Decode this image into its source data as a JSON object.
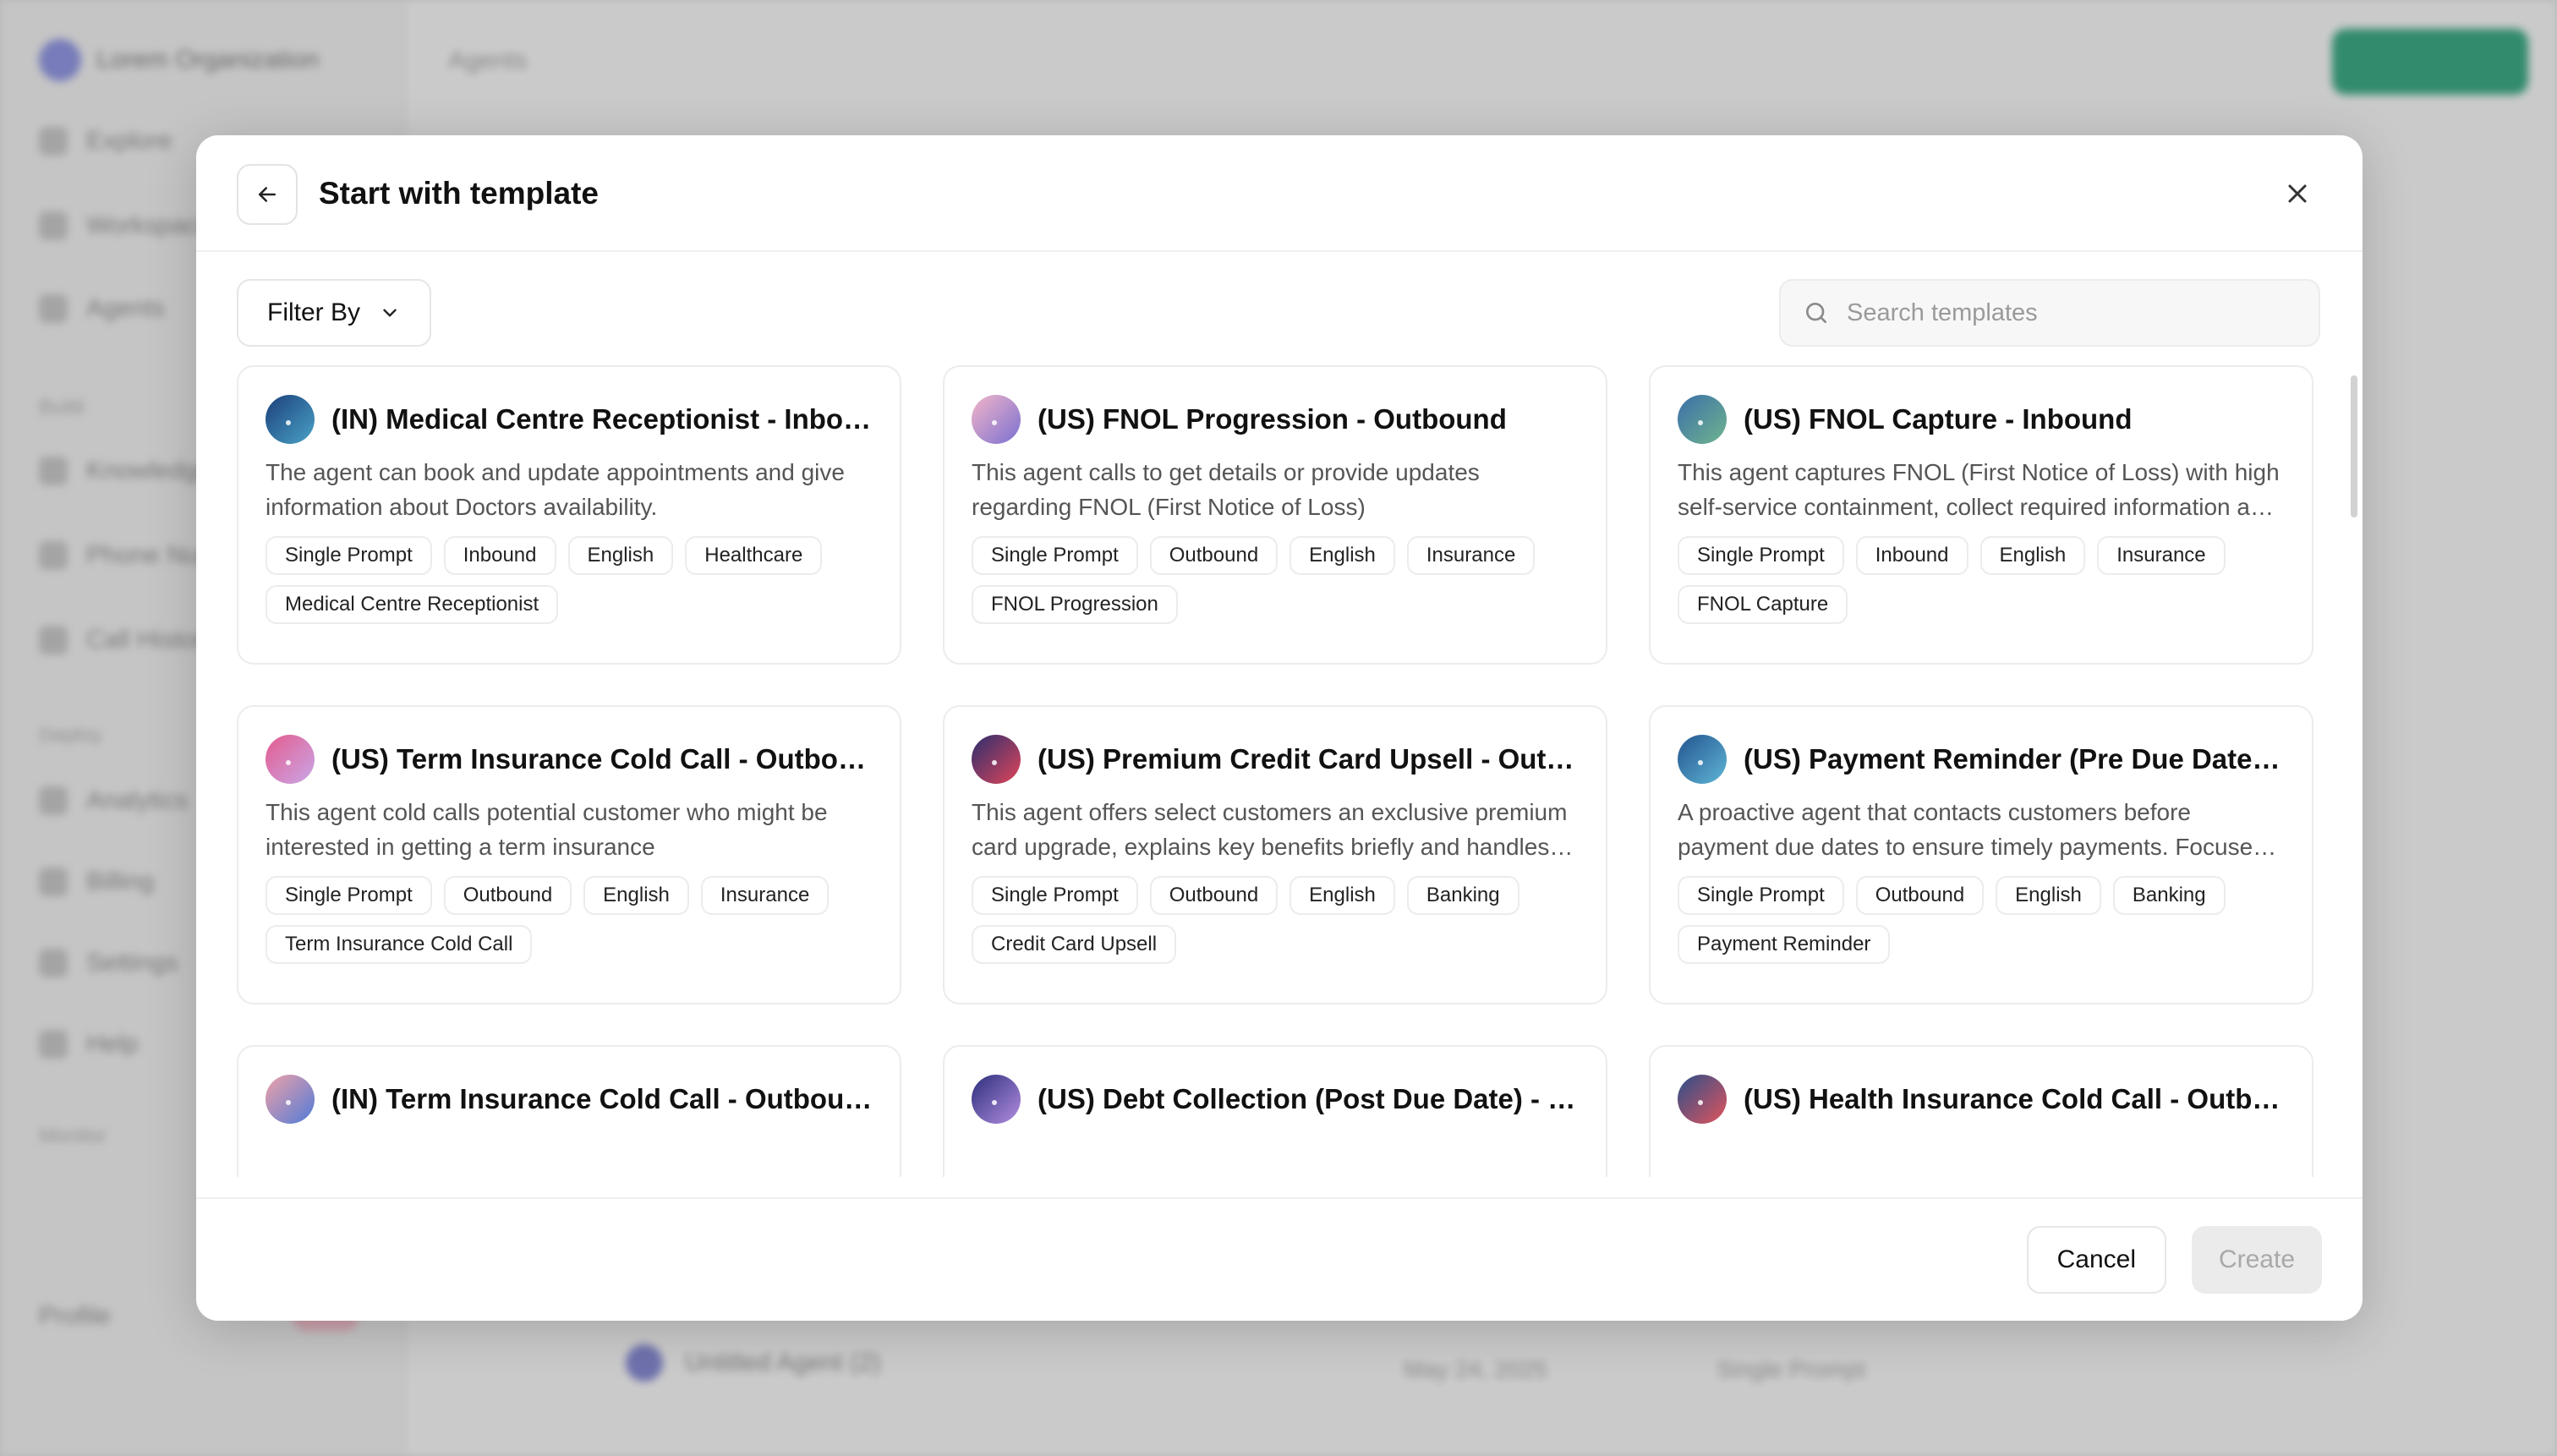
{
  "background": {
    "org_name": "Lorem Organization",
    "page_title": "Agents",
    "row_agent_name": "Untitled Agent (2)",
    "row_date": "May 24, 2025",
    "row_type": "Single Prompt",
    "user_label": "Profile",
    "nav_items": [
      "Explore",
      "Workspace",
      "Agents",
      "Knowledge",
      "Phone Numbers",
      "Call History",
      "Analytics",
      "Billing",
      "Settings",
      "Help"
    ],
    "section_labels": [
      "Build",
      "Deploy",
      "Monitor"
    ]
  },
  "modal": {
    "title": "Start with template",
    "back_icon": "arrow-left-icon",
    "close_icon": "close-icon",
    "filter_label": "Filter By",
    "search_placeholder": "Search templates",
    "cancel_label": "Cancel",
    "create_label": "Create"
  },
  "templates": [
    {
      "title": "(IN) Medical Centre Receptionist - Inbound",
      "description": "The agent can book and update appointments and give information about Doctors availability.",
      "tags": [
        "Single Prompt",
        "Inbound",
        "English",
        "Healthcare",
        "Medical Centre Receptionist"
      ],
      "avatar_colors": [
        "#1b3f7a",
        "#4aa3c8"
      ]
    },
    {
      "title": "(US) FNOL Progression - Outbound",
      "description": "This agent calls to get details or provide updates regarding FNOL (First Notice of Loss)",
      "tags": [
        "Single Prompt",
        "Outbound",
        "English",
        "Insurance",
        "FNOL Progression"
      ],
      "avatar_colors": [
        "#f3b6c8",
        "#7a6fd1"
      ]
    },
    {
      "title": "(US) FNOL Capture - Inbound",
      "description": "This agent captures FNOL (First Notice of Loss) with high self-service containment, collect required information and file the claim.",
      "tags": [
        "Single Prompt",
        "Inbound",
        "English",
        "Insurance",
        "FNOL Capture"
      ],
      "avatar_colors": [
        "#3a6ea8",
        "#6fb58e"
      ]
    },
    {
      "title": "(US) Term Insurance Cold Call - Outbound",
      "description": "This agent cold calls potential customer who might be interested in getting a term insurance",
      "tags": [
        "Single Prompt",
        "Outbound",
        "English",
        "Insurance",
        "Term Insurance Cold Call"
      ],
      "avatar_colors": [
        "#e45a8e",
        "#c9a8e8"
      ]
    },
    {
      "title": "(US) Premium Credit Card Upsell - Outbound",
      "description": "This agent offers select customers an exclusive premium card upgrade, explains key benefits briefly and handles objections.",
      "tags": [
        "Single Prompt",
        "Outbound",
        "English",
        "Banking",
        "Credit Card Upsell"
      ],
      "avatar_colors": [
        "#2c2e6e",
        "#e0455a"
      ]
    },
    {
      "title": "(US) Payment Reminder (Pre Due Date) - Outbound",
      "description": "A proactive agent that contacts customers before payment due dates to ensure timely payments. Focuses on friendly reminders.",
      "tags": [
        "Single Prompt",
        "Outbound",
        "English",
        "Banking",
        "Payment Reminder"
      ],
      "avatar_colors": [
        "#23548f",
        "#5fb6d6"
      ]
    },
    {
      "title": "(IN) Term Insurance Cold Call - Outbound",
      "description": "",
      "tags": [],
      "avatar_colors": [
        "#f0a1a8",
        "#4f7bd8"
      ]
    },
    {
      "title": "(US) Debt Collection (Post Due Date) - Outbound",
      "description": "",
      "tags": [],
      "avatar_colors": [
        "#2b2f7c",
        "#b48de0"
      ]
    },
    {
      "title": "(US) Health Insurance Cold Call - Outbound",
      "description": "",
      "tags": [],
      "avatar_colors": [
        "#2a4f8a",
        "#e2545c"
      ]
    }
  ]
}
